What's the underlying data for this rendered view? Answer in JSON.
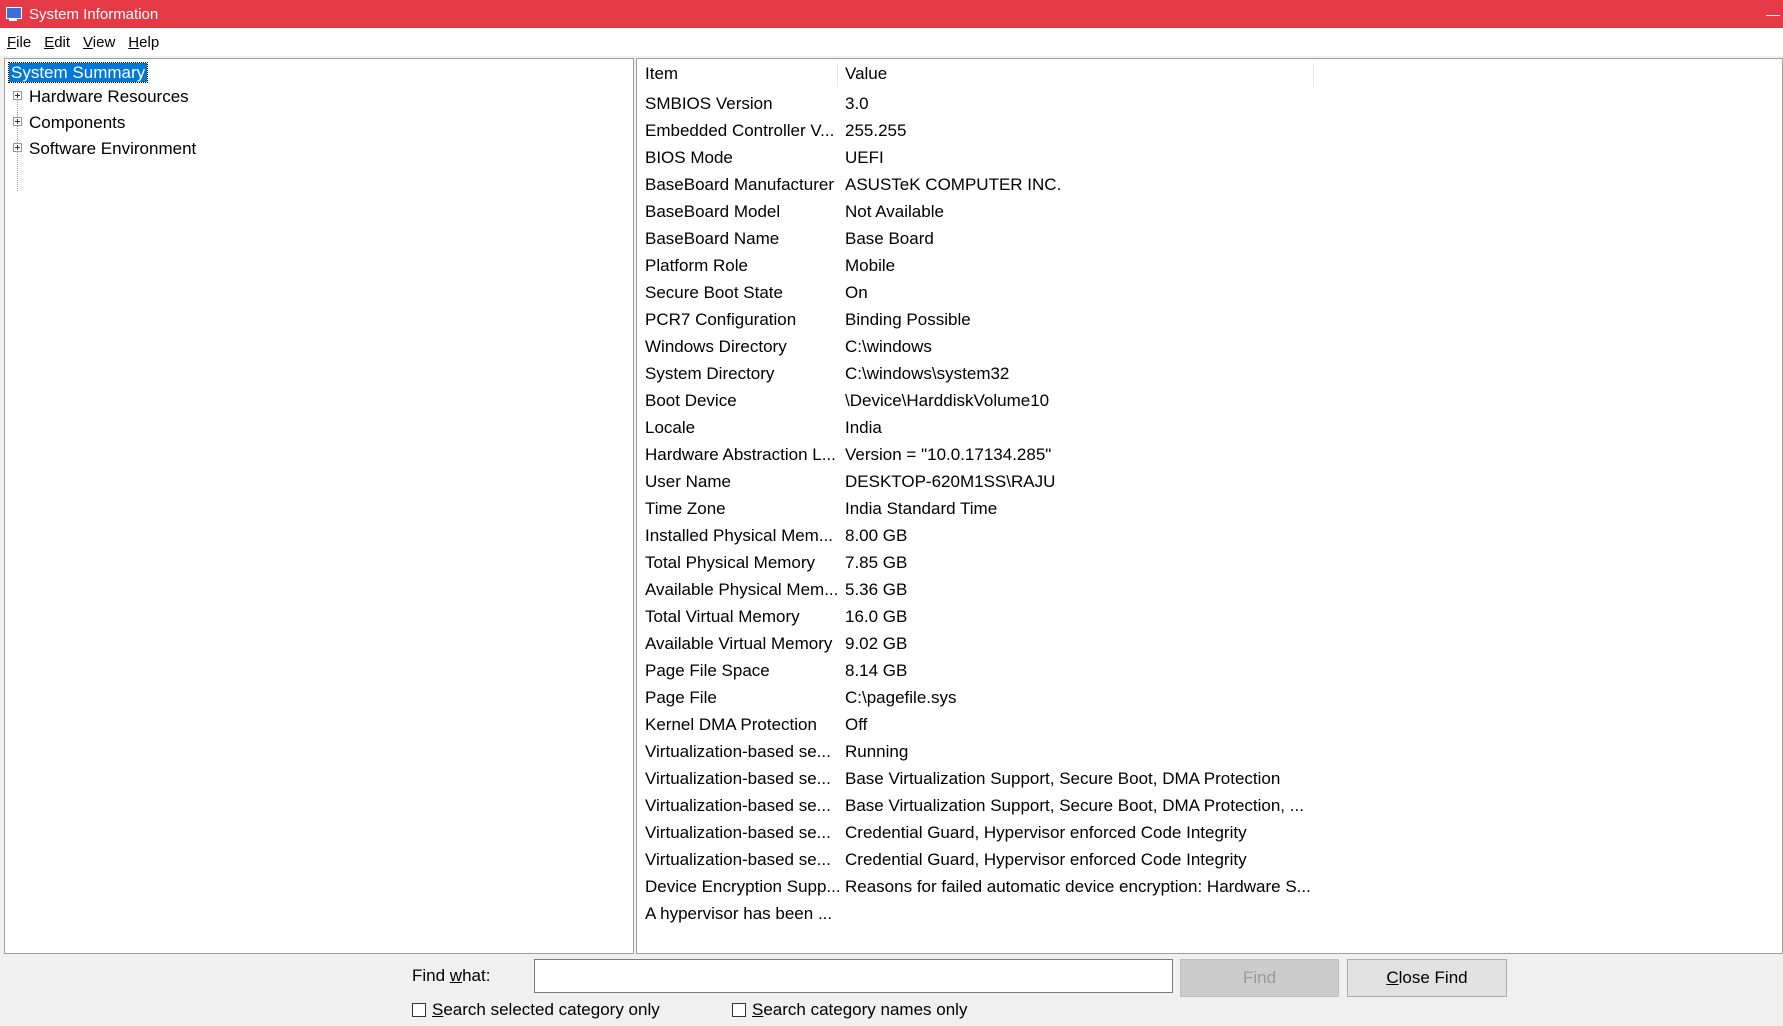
{
  "window": {
    "title": "System Information"
  },
  "menu": [
    {
      "accel": "F",
      "rest": "ile"
    },
    {
      "accel": "E",
      "rest": "dit"
    },
    {
      "accel": "V",
      "rest": "iew"
    },
    {
      "accel": "H",
      "rest": "elp"
    }
  ],
  "tree": {
    "selected": "System Summary",
    "children": [
      "Hardware Resources",
      "Components",
      "Software Environment"
    ]
  },
  "table": {
    "headers": {
      "item": "Item",
      "value": "Value"
    },
    "rows": [
      {
        "item": "SMBIOS Version",
        "value": "3.0"
      },
      {
        "item": "Embedded Controller V...",
        "value": "255.255"
      },
      {
        "item": "BIOS Mode",
        "value": "UEFI"
      },
      {
        "item": "BaseBoard Manufacturer",
        "value": "ASUSTeK COMPUTER INC."
      },
      {
        "item": "BaseBoard Model",
        "value": "Not Available"
      },
      {
        "item": "BaseBoard Name",
        "value": "Base Board"
      },
      {
        "item": "Platform Role",
        "value": "Mobile"
      },
      {
        "item": "Secure Boot State",
        "value": "On"
      },
      {
        "item": "PCR7 Configuration",
        "value": "Binding Possible"
      },
      {
        "item": "Windows Directory",
        "value": "C:\\windows"
      },
      {
        "item": "System Directory",
        "value": "C:\\windows\\system32"
      },
      {
        "item": "Boot Device",
        "value": "\\Device\\HarddiskVolume10"
      },
      {
        "item": "Locale",
        "value": "India"
      },
      {
        "item": "Hardware Abstraction L...",
        "value": "Version = \"10.0.17134.285\""
      },
      {
        "item": "User Name",
        "value": "DESKTOP-620M1SS\\RAJU"
      },
      {
        "item": "Time Zone",
        "value": "India Standard Time"
      },
      {
        "item": "Installed Physical Mem...",
        "value": "8.00 GB"
      },
      {
        "item": "Total Physical Memory",
        "value": "7.85 GB"
      },
      {
        "item": "Available Physical Mem...",
        "value": "5.36 GB"
      },
      {
        "item": "Total Virtual Memory",
        "value": "16.0 GB"
      },
      {
        "item": "Available Virtual Memory",
        "value": "9.02 GB"
      },
      {
        "item": "Page File Space",
        "value": "8.14 GB"
      },
      {
        "item": "Page File",
        "value": "C:\\pagefile.sys"
      },
      {
        "item": "Kernel DMA Protection",
        "value": "Off"
      },
      {
        "item": "Virtualization-based se...",
        "value": "Running"
      },
      {
        "item": "Virtualization-based se...",
        "value": "Base Virtualization Support, Secure Boot, DMA Protection"
      },
      {
        "item": "Virtualization-based se...",
        "value": "Base Virtualization Support, Secure Boot, DMA Protection, ..."
      },
      {
        "item": "Virtualization-based se...",
        "value": "Credential Guard, Hypervisor enforced Code Integrity"
      },
      {
        "item": "Virtualization-based se...",
        "value": "Credential Guard, Hypervisor enforced Code Integrity"
      },
      {
        "item": "Device Encryption Supp...",
        "value": "Reasons for failed automatic device encryption: Hardware S..."
      },
      {
        "item": "A hypervisor has been ...",
        "value": ""
      }
    ]
  },
  "find": {
    "label_pre": "Find ",
    "label_accel": "w",
    "label_post": "hat:",
    "value": "",
    "find_button": "Find",
    "close_accel": "C",
    "close_rest": "lose Find",
    "chk1_accel": "S",
    "chk1_rest": "earch selected category only",
    "chk2_accel": "S",
    "chk2_rest": "earch category names only"
  }
}
